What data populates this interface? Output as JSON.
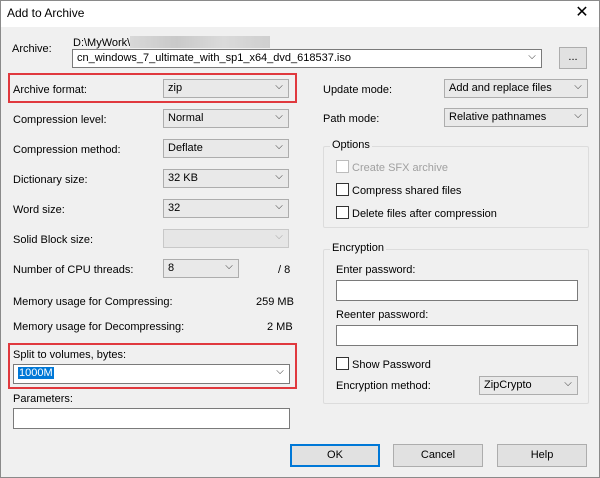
{
  "window": {
    "title": "Add to Archive",
    "close_glyph": "✕"
  },
  "archive": {
    "label": "Archive:",
    "path": "D:\\MyWork\\",
    "filename": "cn_windows_7_ultimate_with_sp1_x64_dvd_618537.iso",
    "browse_label": "..."
  },
  "left": {
    "archive_format": {
      "label": "Archive format:",
      "value": "zip"
    },
    "compression_level": {
      "label": "Compression level:",
      "value": "Normal"
    },
    "compression_method": {
      "label": "Compression method:",
      "value": "Deflate"
    },
    "dictionary_size": {
      "label": "Dictionary size:",
      "value": "32 KB"
    },
    "word_size": {
      "label": "Word size:",
      "value": "32"
    },
    "solid_block_size": {
      "label": "Solid Block size:",
      "value": ""
    },
    "cpu_threads": {
      "label": "Number of CPU threads:",
      "value": "8",
      "max": "/ 8"
    },
    "mem_compress": {
      "label": "Memory usage for Compressing:",
      "value": "259 MB"
    },
    "mem_decompress": {
      "label": "Memory usage for Decompressing:",
      "value": "2 MB"
    },
    "split_volumes": {
      "label": "Split to volumes, bytes:",
      "value": "1000M"
    },
    "parameters": {
      "label": "Parameters:",
      "value": ""
    }
  },
  "right": {
    "update_mode": {
      "label": "Update mode:",
      "value": "Add and replace files"
    },
    "path_mode": {
      "label": "Path mode:",
      "value": "Relative pathnames"
    },
    "options": {
      "title": "Options",
      "create_sfx": "Create SFX archive",
      "compress_shared": "Compress shared files",
      "delete_after": "Delete files after compression"
    },
    "encryption": {
      "title": "Encryption",
      "enter_password": "Enter password:",
      "reenter_password": "Reenter password:",
      "show_password": "Show Password",
      "method_label": "Encryption method:",
      "method_value": "ZipCrypto"
    }
  },
  "buttons": {
    "ok": "OK",
    "cancel": "Cancel",
    "help": "Help"
  },
  "colors": {
    "highlight": "#e0393e",
    "accent": "#0078d7"
  },
  "icons": {
    "dropdown": "chevron-down-icon",
    "close": "close-icon"
  }
}
